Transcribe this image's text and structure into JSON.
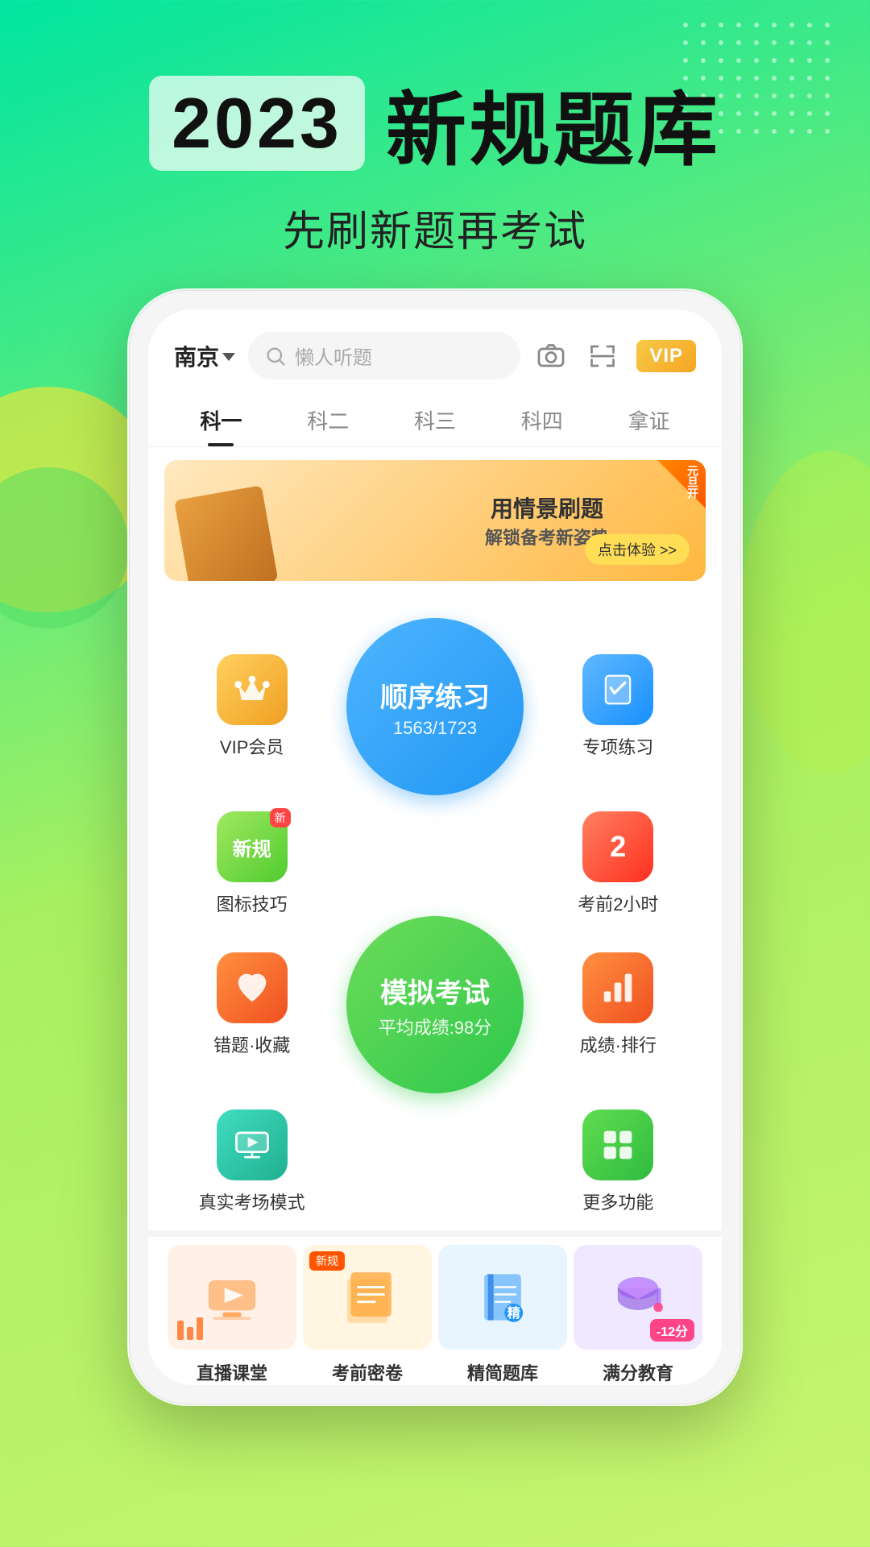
{
  "background": {
    "gradient_start": "#00e5a0",
    "gradient_end": "#c8f570"
  },
  "header": {
    "year": "2023",
    "title_part1": "新规题库",
    "subtitle": "先刷新题再考试"
  },
  "topbar": {
    "city": "南京",
    "search_placeholder": "懒人听题",
    "vip_label": "VIP"
  },
  "nav_tabs": [
    {
      "label": "科一",
      "active": true
    },
    {
      "label": "科二",
      "active": false
    },
    {
      "label": "科三",
      "active": false
    },
    {
      "label": "科四",
      "active": false
    },
    {
      "label": "拿证",
      "active": false
    }
  ],
  "banner": {
    "title": "用情景刷题",
    "subtitle": "解锁备考新姿势",
    "btn_label": "点击体验 >>",
    "corner_text": "元旦开"
  },
  "grid_items": [
    {
      "id": "vip",
      "icon": "👑",
      "label": "VIP会员",
      "icon_class": "icon-gold"
    },
    {
      "id": "special",
      "icon": "✓",
      "label": "专项练习",
      "icon_class": "icon-blue"
    },
    {
      "id": "new-rules",
      "icon": "新规",
      "label": "图标技巧",
      "icon_class": "icon-green-light"
    },
    {
      "id": "exam2h",
      "icon": "2",
      "label": "考前2小时",
      "icon_class": "icon-red"
    },
    {
      "id": "mistakes",
      "icon": "❤",
      "label": "错题·收藏",
      "icon_class": "icon-orange"
    },
    {
      "id": "ranking",
      "icon": "≡",
      "label": "成绩·排行",
      "icon_class": "icon-orange"
    },
    {
      "id": "realroom",
      "icon": "▶",
      "label": "真实考场模式",
      "icon_class": "icon-teal"
    },
    {
      "id": "more",
      "icon": "⊞",
      "label": "更多功能",
      "icon_class": "icon-green3"
    }
  ],
  "circle_top": {
    "label": "顺序练习",
    "progress": "1563/1723"
  },
  "circle_bottom": {
    "label": "模拟考试",
    "sub": "平均成绩:98分"
  },
  "bottom_items": [
    {
      "label": "直播课堂",
      "color": "#fff0e8",
      "icon": "📺",
      "has_new": false
    },
    {
      "label": "考前密卷",
      "color": "#fff5e0",
      "icon": "📋",
      "has_new": true
    },
    {
      "label": "精简题库",
      "color": "#e8f5ff",
      "icon": "📚",
      "has_new": false
    },
    {
      "label": "满分教育",
      "color": "#f0e8ff",
      "icon": "🎓",
      "has_new": false
    }
  ]
}
